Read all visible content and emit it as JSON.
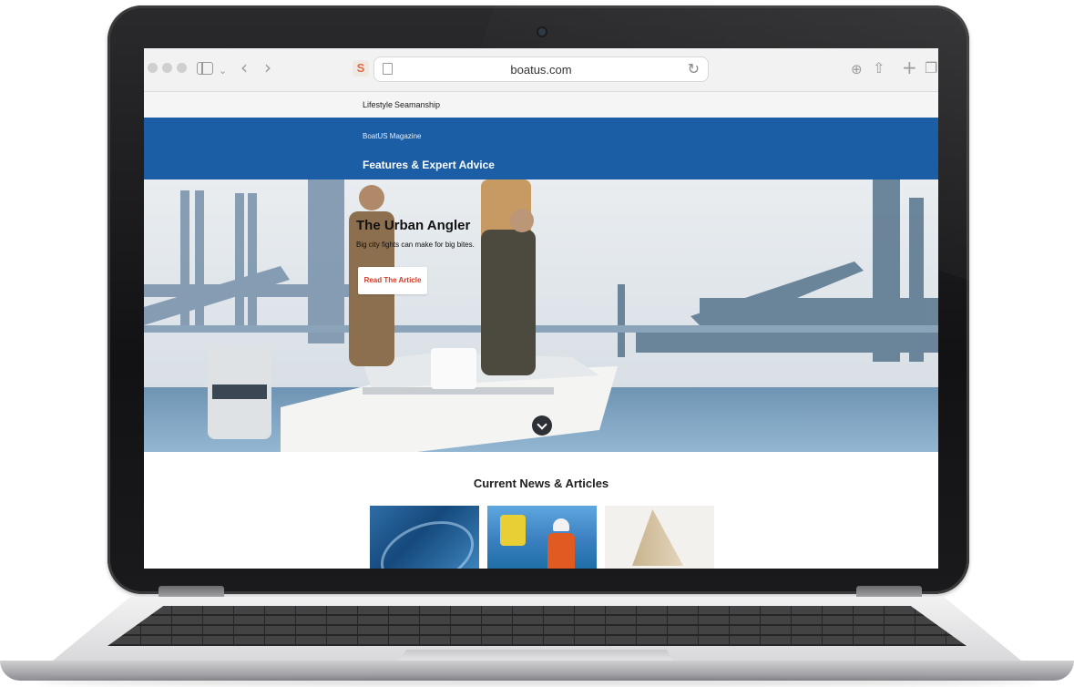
{
  "browser": {
    "url": "boatus.com",
    "icons": [
      "sidebar-icon",
      "chevron-down-icon",
      "back-icon",
      "forward-icon",
      "extension-icon",
      "page-icon",
      "reload-icon",
      "download-icon",
      "share-icon",
      "new-tab-icon",
      "tabs-icon"
    ]
  },
  "site": {
    "nav": [
      "Lifestyle",
      "Seamanship"
    ],
    "magazine_label": "BoatUS Magazine",
    "section_title": "Features & Expert Advice",
    "hero": {
      "title": "The Urban Angler",
      "subtitle": "Big city fights can make for big bites.",
      "button_label": "Read The Article"
    },
    "news_heading": "Current News & Articles",
    "colors": {
      "brand_blue": "#1b5ea6",
      "button_text": "#cf3a26"
    }
  }
}
